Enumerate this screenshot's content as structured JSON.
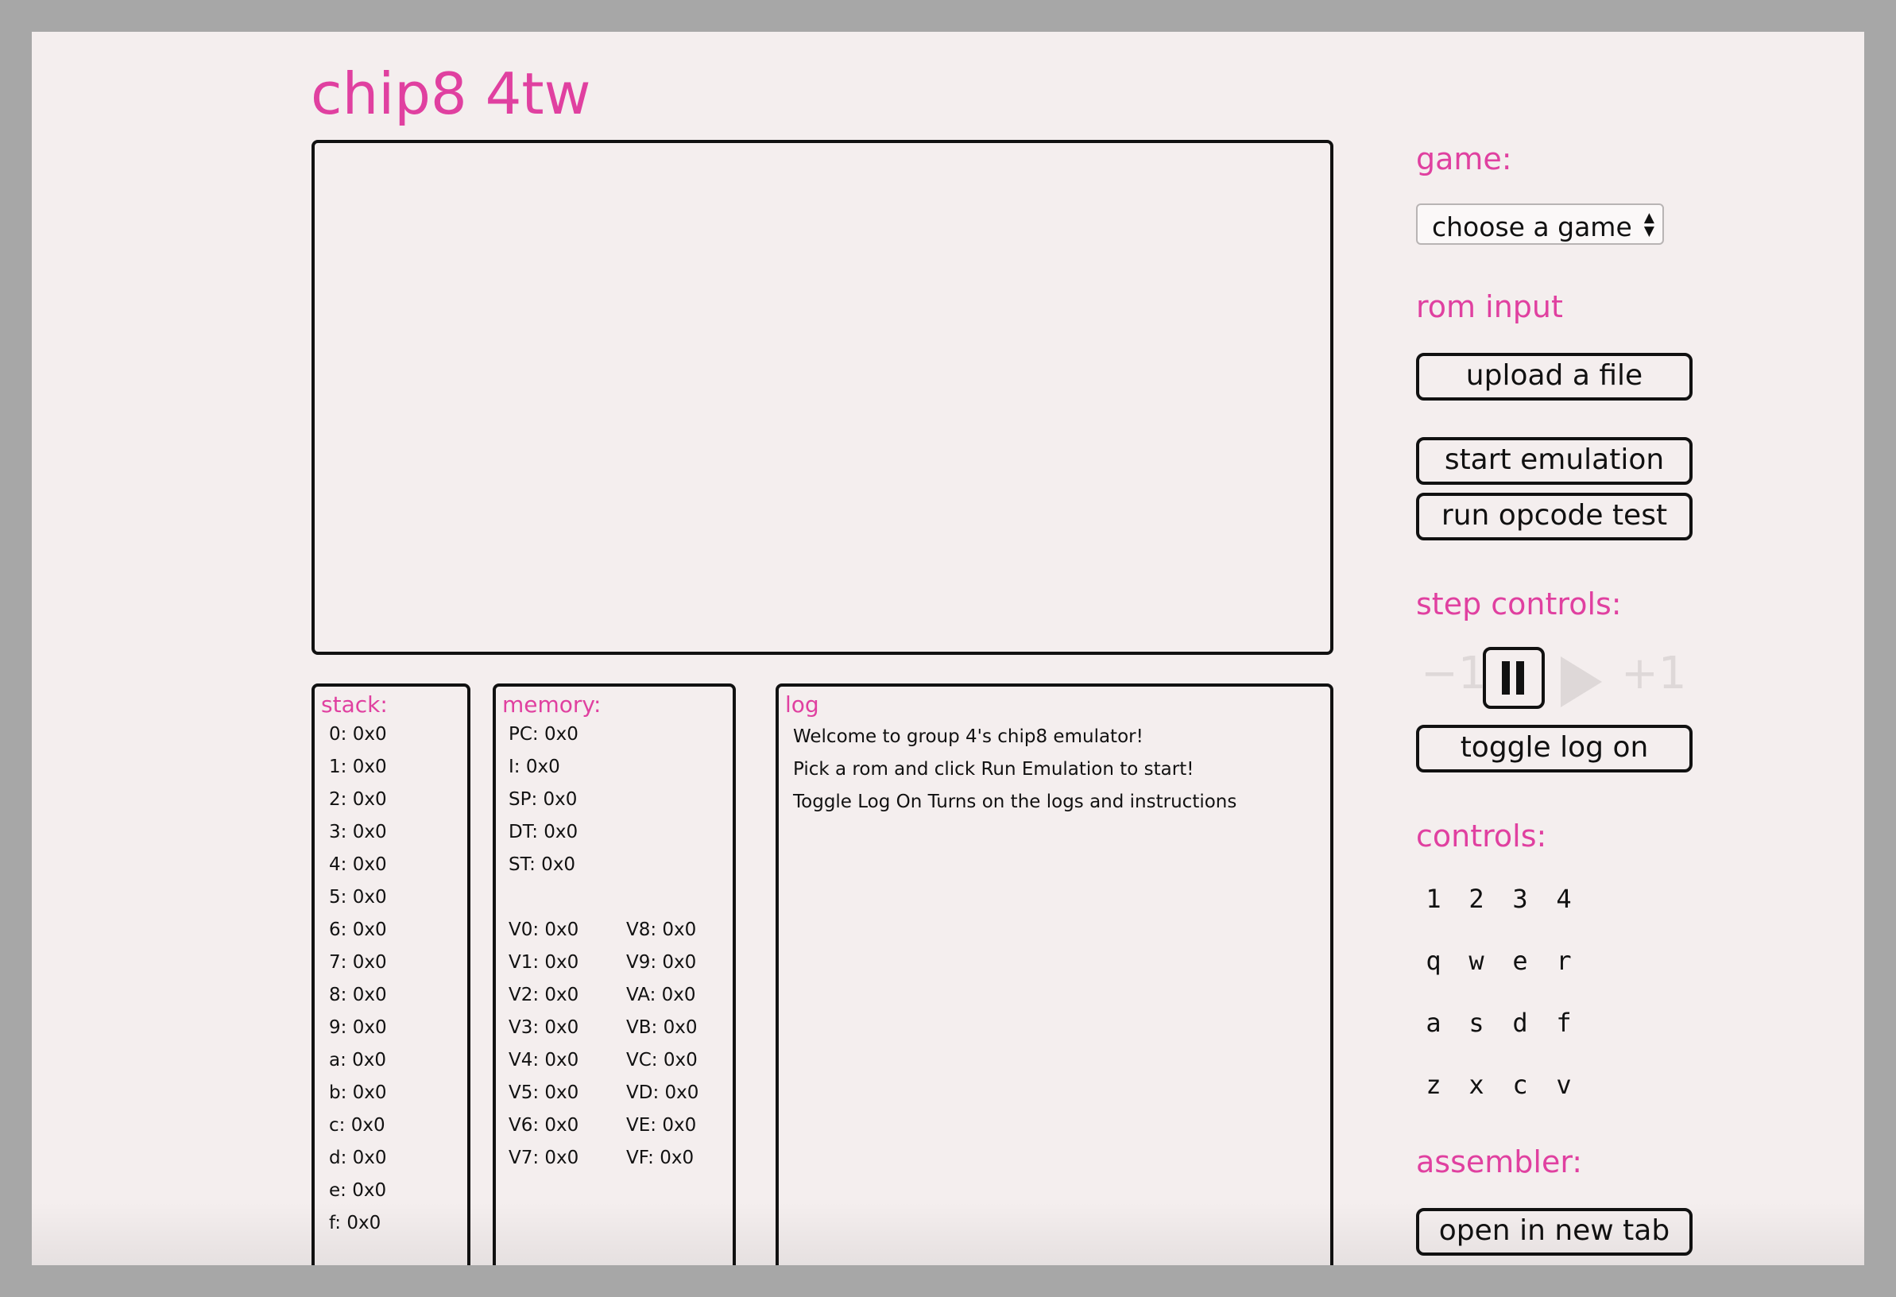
{
  "app": {
    "title": "chip8 4tw"
  },
  "stack": {
    "title": "stack:",
    "entries": [
      "0: 0x0",
      "1: 0x0",
      "2: 0x0",
      "3: 0x0",
      "4: 0x0",
      "5: 0x0",
      "6: 0x0",
      "7: 0x0",
      "8: 0x0",
      "9: 0x0",
      "a: 0x0",
      "b: 0x0",
      "c: 0x0",
      "d: 0x0",
      "e: 0x0",
      "f: 0x0"
    ]
  },
  "memory": {
    "title": "memory:",
    "registers": [
      "PC: 0x0",
      "I: 0x0",
      "SP: 0x0",
      "DT: 0x0",
      "ST: 0x0"
    ],
    "v_left": [
      "V0: 0x0",
      "V1: 0x0",
      "V2: 0x0",
      "V3: 0x0",
      "V4: 0x0",
      "V5: 0x0",
      "V6: 0x0",
      "V7: 0x0"
    ],
    "v_right": [
      "V8: 0x0",
      "V9: 0x0",
      "VA: 0x0",
      "VB: 0x0",
      "VC: 0x0",
      "VD: 0x0",
      "VE: 0x0",
      "VF: 0x0"
    ]
  },
  "log": {
    "title": "log",
    "line1": "Welcome to group 4's chip8 emulator!",
    "line2_pre": "Pick a rom and click ",
    "line2_bold": "Run Emulation",
    "line2_post": " to start!",
    "line3_bold": "Toggle Log On",
    "line3_post": " Turns on the logs and instructions"
  },
  "sidebar": {
    "game_heading": "game:",
    "game_select_value": "choose a game",
    "rom_heading": "rom input",
    "upload_label": "upload a file",
    "start_label": "start emulation",
    "opcode_label": "run opcode test",
    "step_heading": "step controls:",
    "step_back": "−1",
    "step_forward": "+1",
    "toggle_log_label": "toggle log on",
    "controls_heading": "controls:",
    "keys": [
      [
        "1",
        "2",
        "3",
        "4"
      ],
      [
        "q",
        "w",
        "e",
        "r"
      ],
      [
        "a",
        "s",
        "d",
        "f"
      ],
      [
        "z",
        "x",
        "c",
        "v"
      ]
    ],
    "assembler_heading": "assembler:",
    "assembler_label": "open in new tab"
  },
  "colors": {
    "accent": "#e040a0",
    "background": "#f4eeee",
    "frame": "#a7a7a7",
    "disabled": "#ded8d8"
  },
  "icons": {
    "pause": "pause-icon",
    "play": "play-icon",
    "select_arrows": "select-arrows-icon"
  }
}
